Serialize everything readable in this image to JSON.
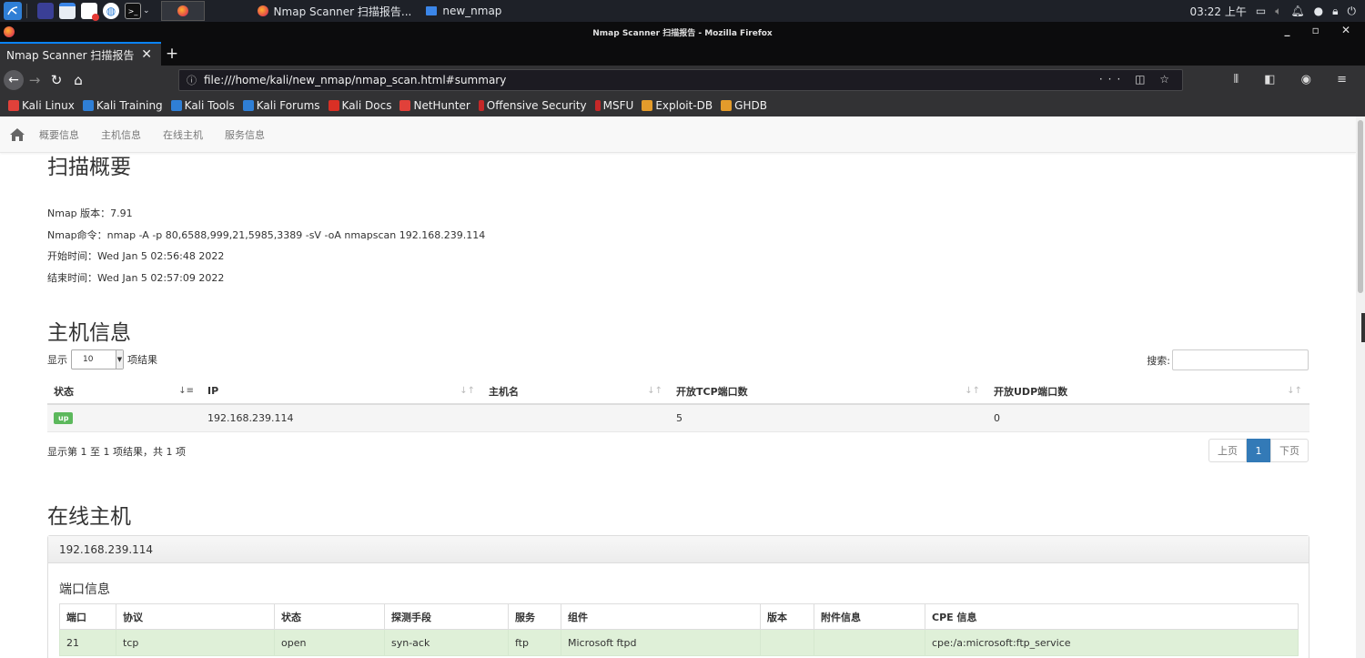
{
  "taskbar": {
    "tasks": [
      {
        "label": "Nmap Scanner 扫描报告...",
        "icon": "firefox-icon"
      },
      {
        "label": "new_nmap",
        "icon": "folder-icon"
      }
    ],
    "clock": "03:22 上午"
  },
  "window": {
    "title": "Nmap Scanner 扫描报告 - Mozilla Firefox"
  },
  "tab": {
    "label": "Nmap Scanner 扫描报告",
    "close": "✕",
    "new": "+"
  },
  "url": "file:///home/kali/new_nmap/nmap_scan.html#summary",
  "bookmarks": [
    {
      "label": "Kali Linux",
      "color": "#e1413a"
    },
    {
      "label": "Kali Training",
      "color": "#2f7fd6"
    },
    {
      "label": "Kali Tools",
      "color": "#2f7fd6"
    },
    {
      "label": "Kali Forums",
      "color": "#2f7fd6"
    },
    {
      "label": "Kali Docs",
      "color": "#d93025"
    },
    {
      "label": "NetHunter",
      "color": "#e1413a"
    },
    {
      "label": "Offensive Security",
      "color": "#c62828"
    },
    {
      "label": "MSFU",
      "color": "#c62828"
    },
    {
      "label": "Exploit-DB",
      "color": "#e39b2b"
    },
    {
      "label": "GHDB",
      "color": "#e39b2b"
    }
  ],
  "nav": {
    "items": [
      "概要信息",
      "主机信息",
      "在线主机",
      "服务信息"
    ]
  },
  "summary": {
    "title": "扫描概要",
    "version": "Nmap 版本：7.91",
    "command": "Nmap命令：nmap -A -p 80,6588,999,21,5985,3389 -sV -oA nmapscan 192.168.239.114",
    "start": "开始时间：Wed Jan 5 02:56:48 2022",
    "end": "结束时间：Wed Jan 5 02:57:09 2022"
  },
  "hosts": {
    "title": "主机信息",
    "show_label": "显示",
    "page_size": "10",
    "suffix_label": "项结果",
    "search_label": "搜索:",
    "columns": [
      "状态",
      "IP",
      "主机名",
      "开放TCP端口数",
      "开放UDP端口数"
    ],
    "rows": [
      {
        "status": "up",
        "ip": "192.168.239.114",
        "hostname": "",
        "tcp": "5",
        "udp": "0"
      }
    ],
    "info": "显示第 1 至 1 项结果，共 1 项",
    "prev": "上页",
    "page": "1",
    "next": "下页"
  },
  "online": {
    "title": "在线主机",
    "host": "192.168.239.114",
    "ports_title": "端口信息",
    "columns": [
      "端口",
      "协议",
      "状态",
      "探测手段",
      "服务",
      "组件",
      "版本",
      "附件信息",
      "CPE 信息"
    ],
    "rows": [
      {
        "port": "21",
        "proto": "tcp",
        "state": "open",
        "reason": "syn-ack",
        "service": "ftp",
        "product": "Microsoft ftpd",
        "version": "",
        "extra": "",
        "cpe": "cpe:/a:microsoft:ftp_service"
      }
    ]
  }
}
